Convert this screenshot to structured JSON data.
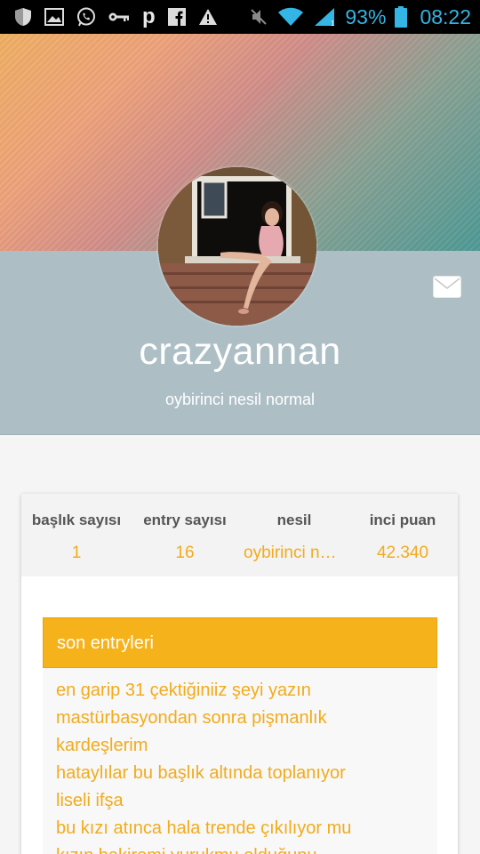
{
  "status_bar": {
    "battery": "93%",
    "time": "08:22",
    "icons_left": [
      "shield-icon",
      "image-icon",
      "whatsapp-icon",
      "key-icon",
      "p-icon",
      "facebook-icon",
      "warning-icon"
    ],
    "icons_right": [
      "mute-icon",
      "wifi-icon",
      "signal-icon",
      "battery-icon"
    ]
  },
  "profile": {
    "username": "crazyannan",
    "title": "oybirinci nesil normal"
  },
  "stats": [
    {
      "label": "başlık sayısı",
      "value": "1"
    },
    {
      "label": "entry sayısı",
      "value": "16"
    },
    {
      "label": "nesil",
      "value": "oybirinci nesil normal"
    },
    {
      "label": "inci puan",
      "value": "42.340"
    }
  ],
  "recent": {
    "header": "son entryleri",
    "entries": [
      "en garip 31 çektiğiniiz şeyi yazın",
      "mastürbasyondan sonra pişmanlık",
      "kardeşlerim",
      "hataylılar bu başlık altında toplanıyor",
      "liseli ifşa",
      "bu kızı atınca hala trende çıkılıyor mu",
      "kızın bakiremi yurukmu olduğunu"
    ]
  },
  "colors": {
    "accent": "#f5b21b",
    "link": "#f2ab1c",
    "band": "#adbfc5",
    "statusbar_text": "#33b5e5"
  }
}
